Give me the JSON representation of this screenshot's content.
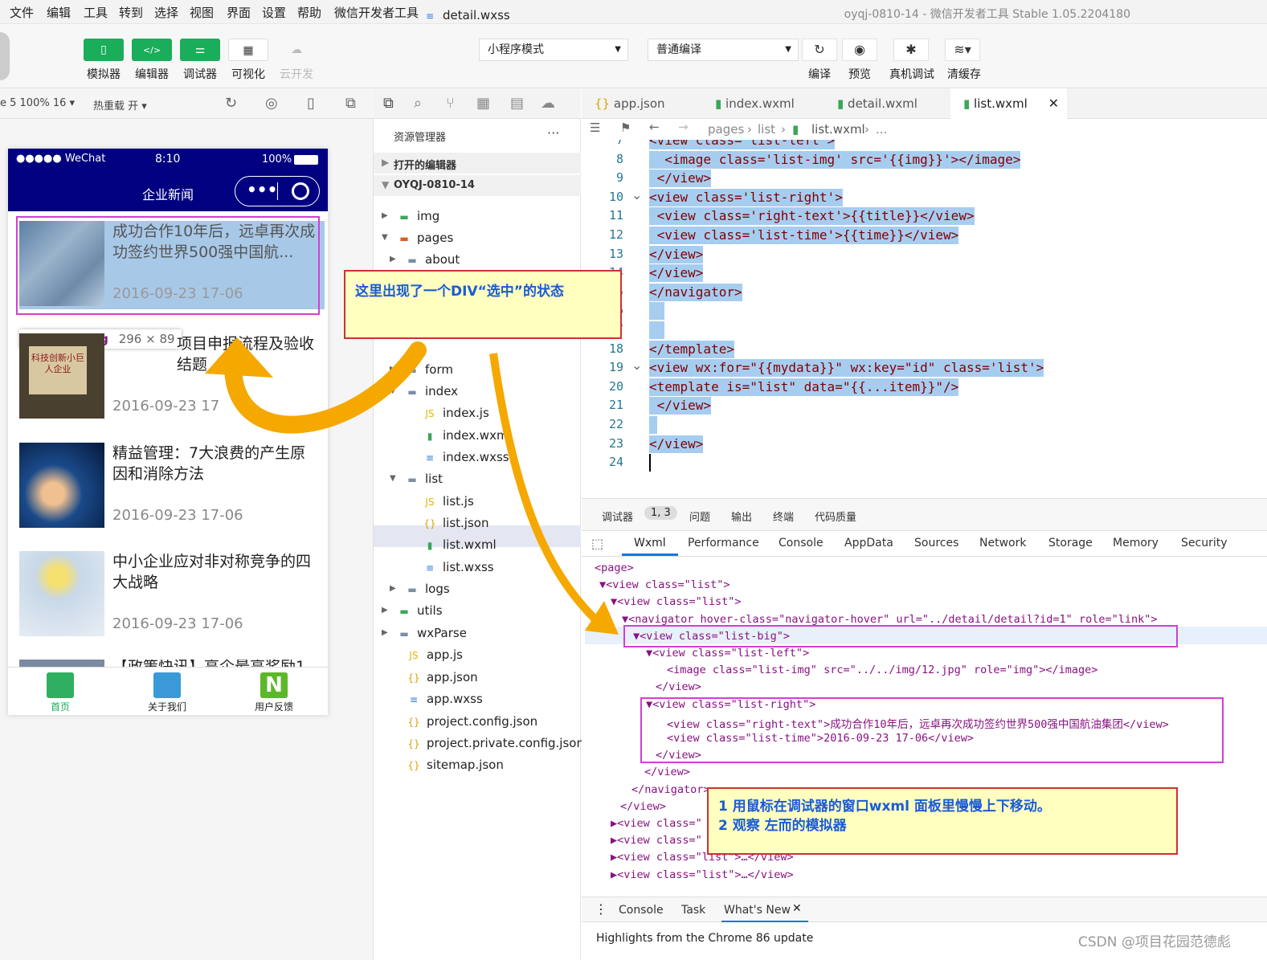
{
  "menu": [
    "文件",
    "编辑",
    "工具",
    "转到",
    "选择",
    "视图",
    "界面",
    "设置",
    "帮助",
    "微信开发者工具"
  ],
  "window_title": "oyqj-0810-14 - 微信开发者工具 Stable 1.05.2204180",
  "toolbar": {
    "buttons": [
      {
        "label": "模拟器",
        "color": "#1aad5a"
      },
      {
        "label": "编辑器",
        "color": "#1aad5a"
      },
      {
        "label": "调试器",
        "color": "#1aad5a"
      },
      {
        "label": "可视化"
      },
      {
        "label": "云开发"
      }
    ],
    "mode_select": "小程序模式",
    "compile_select": "普通编译",
    "actions": [
      "编译",
      "预览",
      "真机调试",
      "清缓存"
    ]
  },
  "simbar": {
    "device": "e 5 100% 16",
    "hotreload": "热重载 开"
  },
  "phone": {
    "carrier": "●●●●● WeChat",
    "time": "8:10",
    "battery": "100%",
    "nav_title": "企业新闻",
    "tooltip_class": "view.list-big",
    "tooltip_size": "296 × 89",
    "news": [
      {
        "title": "成功合作10年后，远卓再次成功签约世界500强中国航...",
        "date": "2016-09-23 17-06"
      },
      {
        "title": "项目申报流程及验收结题",
        "date": "2016-09-23 17",
        "thumb_text": "科技创新小巨人企业"
      },
      {
        "title": "精益管理：7大浪费的产生原因和消除方法",
        "date": "2016-09-23 17-06"
      },
      {
        "title": "中小企业应对非对称竞争的四大战略",
        "date": "2016-09-23 17-06"
      },
      {
        "title": "【政策快讯】高企最高奖励1",
        "date": ""
      }
    ],
    "tabs": [
      "首页",
      "关于我们",
      "用户反馈"
    ]
  },
  "explorer": {
    "title": "资源管理器",
    "open_editors": "打开的编辑器",
    "project": "OYQJ-0810-14",
    "items": [
      {
        "name": "img",
        "icon": "folder-green"
      },
      {
        "name": "pages",
        "icon": "folder-red"
      },
      {
        "name": "about",
        "icon": "folder"
      },
      {
        "name": "detail.wxss",
        "icon": "wxss"
      },
      {
        "name": "form",
        "icon": "folder"
      },
      {
        "name": "index",
        "icon": "folder"
      },
      {
        "name": "index.js",
        "icon": "js"
      },
      {
        "name": "index.wxml",
        "icon": "wxml"
      },
      {
        "name": "index.wxss",
        "icon": "wxss"
      },
      {
        "name": "list",
        "icon": "folder"
      },
      {
        "name": "list.js",
        "icon": "js"
      },
      {
        "name": "list.json",
        "icon": "json"
      },
      {
        "name": "list.wxml",
        "icon": "wxml"
      },
      {
        "name": "list.wxss",
        "icon": "wxss"
      },
      {
        "name": "logs",
        "icon": "folder"
      },
      {
        "name": "utils",
        "icon": "folder-green"
      },
      {
        "name": "wxParse",
        "icon": "folder"
      },
      {
        "name": "app.js",
        "icon": "js"
      },
      {
        "name": "app.json",
        "icon": "json"
      },
      {
        "name": "app.wxss",
        "icon": "wxss"
      },
      {
        "name": "project.config.json",
        "icon": "json"
      },
      {
        "name": "project.private.config.json",
        "icon": "json"
      },
      {
        "name": "sitemap.json",
        "icon": "json"
      }
    ]
  },
  "editor": {
    "tabs": [
      "app.json",
      "index.wxml",
      "detail.wxml",
      "list.wxml"
    ],
    "breadcrumb": [
      "pages",
      "list",
      "list.wxml",
      "..."
    ],
    "lines": [
      {
        "n": "7",
        "code": "<view class='list-left'>"
      },
      {
        "n": "8",
        "code": "  <image class='list-img' src='{{img}}'></image>"
      },
      {
        "n": "9",
        "code": " </view>"
      },
      {
        "n": "10",
        "code": "<view class='list-right'>"
      },
      {
        "n": "11",
        "code": " <view class='right-text'>{{title}}</view>"
      },
      {
        "n": "12",
        "code": " <view class='list-time'>{{time}}</view>"
      },
      {
        "n": "13",
        "code": "</view>"
      },
      {
        "n": "14",
        "code": "</view>"
      },
      {
        "n": "15",
        "code": "</navigator>"
      },
      {
        "n": "16",
        "code": "  "
      },
      {
        "n": "17",
        "code": "  "
      },
      {
        "n": "18",
        "code": "</template>"
      },
      {
        "n": "19",
        "code": "<view wx:for=\"{{mydata}}\" wx:key=\"id\" class='list'>"
      },
      {
        "n": "20",
        "code": "<template is=\"list\" data=\"{{...item}}\"/>"
      },
      {
        "n": "21",
        "code": " </view>"
      },
      {
        "n": "22",
        "code": " "
      },
      {
        "n": "23",
        "code": "</view>"
      },
      {
        "n": "24",
        "code": ""
      }
    ]
  },
  "debugger": {
    "tabs": [
      "调试器",
      "问题",
      "输出",
      "终端",
      "代码质量"
    ],
    "badge": "1, 3",
    "subtabs": [
      "Wxml",
      "Performance",
      "Console",
      "AppData",
      "Sources",
      "Network",
      "Storage",
      "Memory",
      "Security"
    ],
    "wxml": [
      "<page>",
      "▼<view class=\"list\">",
      "▼<view class=\"list\">",
      "▼<navigator hover-class=\"navigator-hover\" url=\"../detail/detail?id=1\" role=\"link\">",
      "▼<view class=\"list-big\">",
      "▼<view class=\"list-left\">",
      "<image class=\"list-img\" src=\"../../img/12.jpg\" role=\"img\"></image>",
      "</view>",
      "▼<view class=\"list-right\">",
      "<view class=\"right-text\">成功合作10年后，远卓再次成功签约世界500强中国航油集团</view>",
      "<view class=\"list-time\">2016-09-23 17-06</view>",
      "</view>",
      "</view>",
      "</navigator>",
      "</view>",
      "▶<view class=\"",
      "▶<view class=\"",
      "▶<view class=\"list\">…</view>",
      "▶<view class=\"list\">…</view>"
    ],
    "drawer_tabs": [
      "Console",
      "Task",
      "What's New"
    ],
    "drawer_text": "Highlights from the Chrome 86 update"
  },
  "notes": {
    "note1": "这里出现了一个DIV“选中”的状态",
    "note2_line1": "1 用鼠标在调试器的窗口wxml 面板里慢慢上下移动。",
    "note2_line2": "2 观察 左而的模拟器"
  },
  "watermark": "CSDN @项目花园范德彪"
}
